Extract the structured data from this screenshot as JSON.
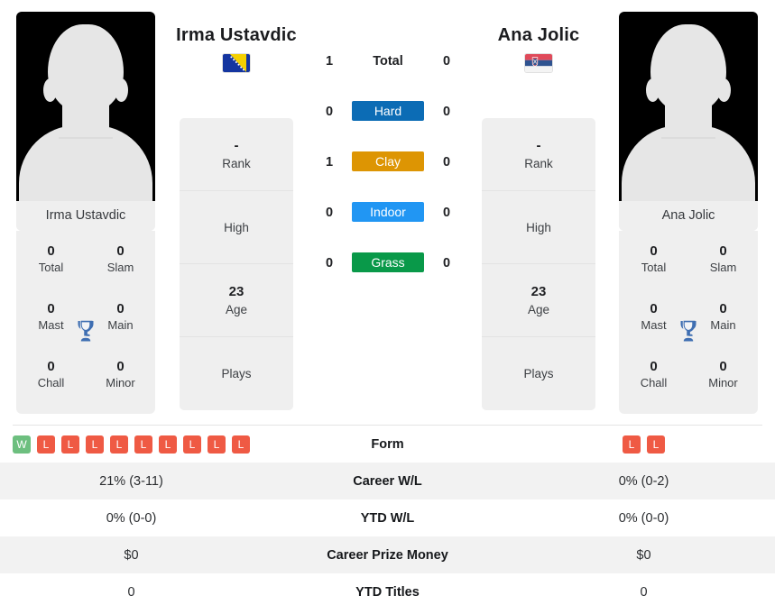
{
  "colors": {
    "hard": "#0c6cb5",
    "clay": "#dd9503",
    "indoor": "#2196f3",
    "grass": "#099949",
    "win": "#6dbf7f",
    "loss": "#ef5a44",
    "trophy": "#3f6fb2",
    "panel_bg": "#efefef",
    "row_alt": "#f2f2f2"
  },
  "players": {
    "left": {
      "name": "Irma Ustavdic",
      "avatar_caption": "Irma Ustavdic",
      "flag": "bosnia-and-herzegovina-flag-icon",
      "info": [
        {
          "value": "-",
          "key": "Rank"
        },
        {
          "value": "",
          "key": "High"
        },
        {
          "value": "23",
          "key": "Age"
        },
        {
          "value": "",
          "key": "Plays"
        }
      ],
      "titles": [
        {
          "value": "0",
          "key": "Total"
        },
        {
          "value": "0",
          "key": "Slam"
        },
        {
          "value": "0",
          "key": "Mast"
        },
        {
          "value": "0",
          "key": "Main"
        },
        {
          "value": "0",
          "key": "Chall"
        },
        {
          "value": "0",
          "key": "Minor"
        }
      ]
    },
    "right": {
      "name": "Ana Jolic",
      "avatar_caption": "Ana Jolic",
      "flag": "serbia-flag-icon",
      "info": [
        {
          "value": "-",
          "key": "Rank"
        },
        {
          "value": "",
          "key": "High"
        },
        {
          "value": "23",
          "key": "Age"
        },
        {
          "value": "",
          "key": "Plays"
        }
      ],
      "titles": [
        {
          "value": "0",
          "key": "Total"
        },
        {
          "value": "0",
          "key": "Slam"
        },
        {
          "value": "0",
          "key": "Mast"
        },
        {
          "value": "0",
          "key": "Main"
        },
        {
          "value": "0",
          "key": "Chall"
        },
        {
          "value": "0",
          "key": "Minor"
        }
      ]
    }
  },
  "surfaces": [
    {
      "label": "Total",
      "left": "1",
      "right": "0",
      "badge": false,
      "color": ""
    },
    {
      "label": "Hard",
      "left": "0",
      "right": "0",
      "badge": true,
      "color": "#0c6cb5"
    },
    {
      "label": "Clay",
      "left": "1",
      "right": "0",
      "badge": true,
      "color": "#dd9503"
    },
    {
      "label": "Indoor",
      "left": "0",
      "right": "0",
      "badge": true,
      "color": "#2196f3"
    },
    {
      "label": "Grass",
      "left": "0",
      "right": "0",
      "badge": true,
      "color": "#099949"
    }
  ],
  "stats_rows": [
    {
      "label": "Form",
      "type": "form",
      "left_form": [
        "W",
        "L",
        "L",
        "L",
        "L",
        "L",
        "L",
        "L",
        "L",
        "L"
      ],
      "right_form": [
        "L",
        "L"
      ],
      "left": "",
      "right": ""
    },
    {
      "label": "Career W/L",
      "type": "text",
      "left": "21% (3-11)",
      "right": "0% (0-2)"
    },
    {
      "label": "YTD W/L",
      "type": "text",
      "left": "0% (0-0)",
      "right": "0% (0-0)"
    },
    {
      "label": "Career Prize Money",
      "type": "text",
      "left": "$0",
      "right": "$0"
    },
    {
      "label": "YTD Titles",
      "type": "text",
      "left": "0",
      "right": "0"
    }
  ]
}
